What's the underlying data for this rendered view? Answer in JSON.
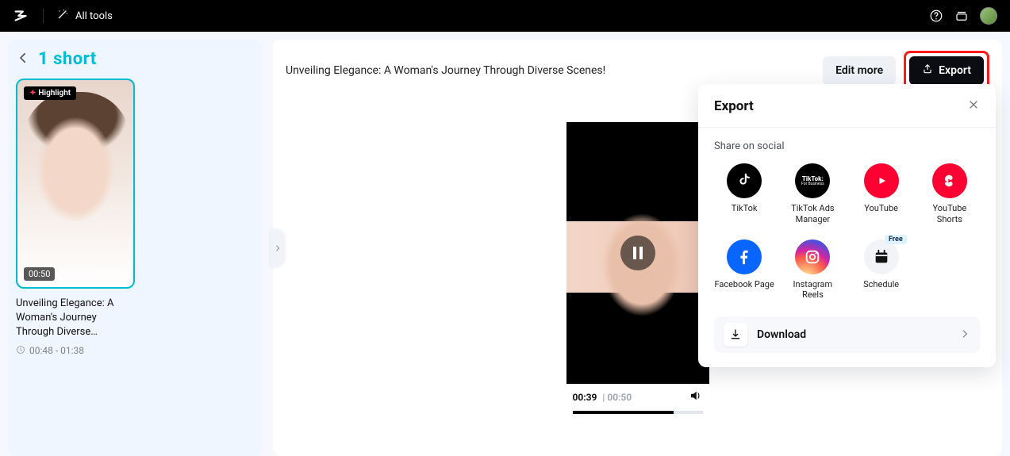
{
  "topbar": {
    "all_tools": "All tools"
  },
  "sidebar": {
    "count_label": "1 short",
    "thumb": {
      "highlight_badge": "Highlight",
      "duration_badge": "00:50",
      "title": "Unveiling Elegance: A Woman's Journey Through Diverse…",
      "range": "00:48 - 01:38"
    }
  },
  "content": {
    "title": "Unveiling Elegance: A Woman's Journey Through Diverse Scenes!",
    "edit_more": "Edit more",
    "export": "Export",
    "player": {
      "current": "00:39",
      "total": "00:50"
    }
  },
  "export_panel": {
    "title": "Export",
    "share_label": "Share on social",
    "download": "Download",
    "schedule_free": "Free",
    "items": {
      "tiktok": "TikTok",
      "tiktok_ads": "TikTok Ads Manager",
      "youtube": "YouTube",
      "youtube_shorts": "YouTube Shorts",
      "facebook": "Facebook Page",
      "instagram": "Instagram Reels",
      "schedule": "Schedule"
    }
  }
}
